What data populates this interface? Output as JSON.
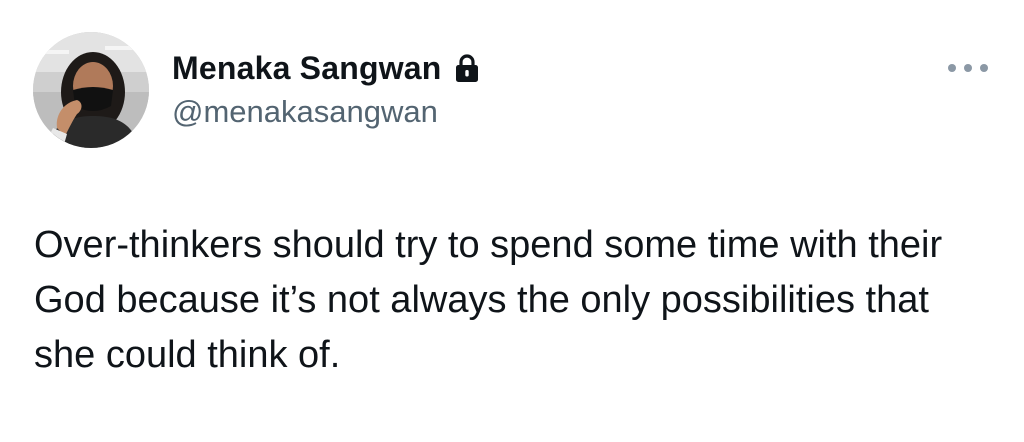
{
  "tweet": {
    "author": {
      "display_name": "Menaka Sangwan",
      "handle": "@menakasangwan",
      "protected_icon": "lock-icon",
      "avatar_icon": "profile-photo"
    },
    "more_icon": "more-horizontal-icon",
    "text": "Over-thinkers should try to spend some time with their God because it’s not always the only possibilities that she could think of."
  },
  "colors": {
    "text_primary": "#0f1419",
    "text_secondary": "#536471",
    "icon_muted": "#8b98a5",
    "background": "#ffffff"
  }
}
